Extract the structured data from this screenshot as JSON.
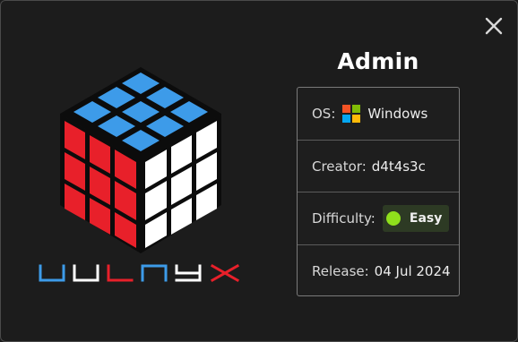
{
  "modal": {
    "close_icon": "close-icon",
    "logo": {
      "icon": "rubiks-cube-icon",
      "wordmark": "VULNYX"
    },
    "title": "Admin",
    "info": {
      "os": {
        "label": "OS:",
        "value": "Windows",
        "icon": "windows-logo-icon"
      },
      "creator": {
        "label": "Creator:",
        "value": "d4t4s3c"
      },
      "difficulty": {
        "label": "Difficulty:",
        "value": "Easy",
        "color": "#8fe01c"
      },
      "release": {
        "label": "Release:",
        "value": "04 Jul 2024"
      }
    }
  },
  "colors": {
    "cube_top": "#3d9be9",
    "cube_left": "#e8202a",
    "cube_right": "#ffffff",
    "background": "#1c1c1c"
  }
}
